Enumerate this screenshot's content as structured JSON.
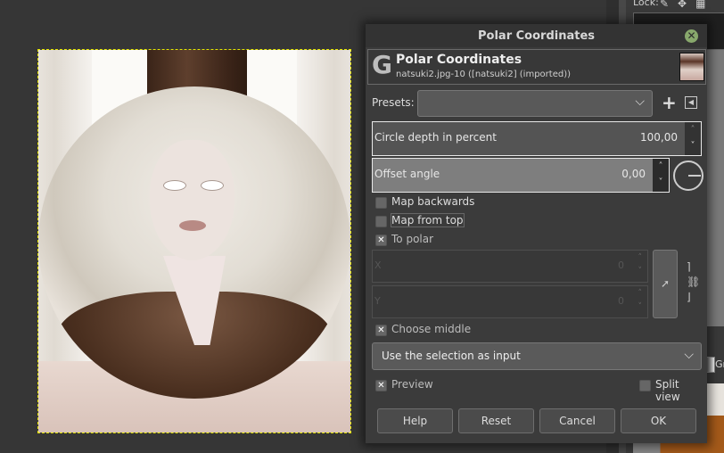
{
  "app": {
    "image_name": "natsuki2.jpg-10 ([natsuki2] (imported))"
  },
  "right_dock": {
    "lock_label": "Lock:",
    "gradient_label": "Gr"
  },
  "dialog": {
    "title": "Polar Coordinates",
    "close_icon": "close-icon",
    "header": {
      "title": "Polar Coordinates",
      "subtitle": "natsuki2.jpg-10 ([natsuki2] (imported))",
      "logo": "G"
    },
    "presets": {
      "label": "Presets:",
      "value": "",
      "add_icon": "+",
      "menu_icon": "◀"
    },
    "circle_depth": {
      "label": "Circle depth in percent",
      "value": "100,00"
    },
    "offset_angle": {
      "label": "Offset angle",
      "value": "0,00"
    },
    "checkboxes": [
      {
        "label": "Map backwards",
        "checked": false
      },
      {
        "label": "Map from top",
        "checked": false
      },
      {
        "label": "To polar",
        "checked": true
      }
    ],
    "x_field": {
      "label": "X",
      "value": "0"
    },
    "y_field": {
      "label": "Y",
      "value": "0"
    },
    "choose_middle": {
      "label": "Choose middle",
      "checked": true
    },
    "input_combo": {
      "value": "Use the selection as input"
    },
    "preview": {
      "label": "Preview",
      "checked": true
    },
    "split_view": {
      "label": "Split view",
      "checked": false
    },
    "buttons": {
      "help": "Help",
      "reset": "Reset",
      "cancel": "Cancel",
      "ok": "OK"
    },
    "check_mark": "✕",
    "chevron": "⌵",
    "arrow_up": "˄",
    "arrow_down": "˅",
    "pointer": "➚",
    "chain": "]\n⛓\n]"
  }
}
